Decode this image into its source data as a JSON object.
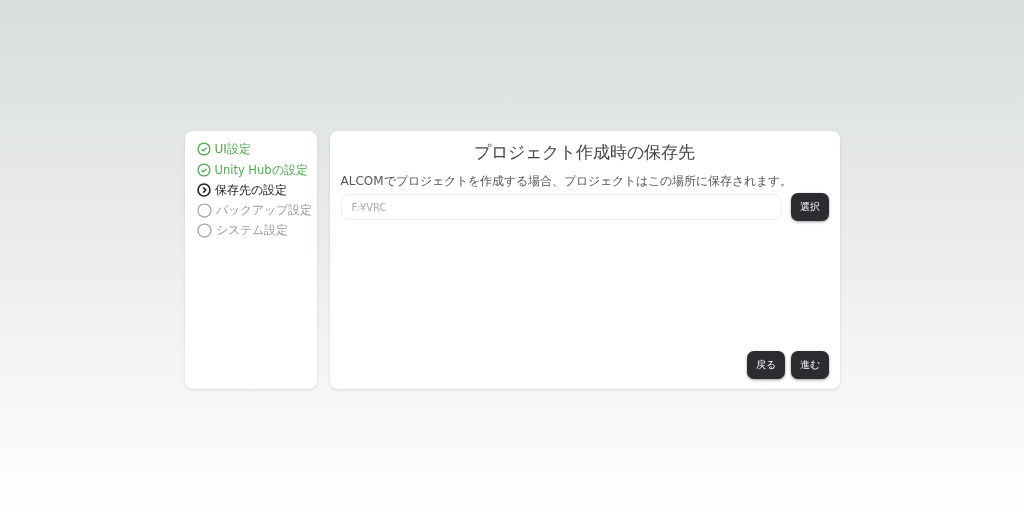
{
  "steps": [
    {
      "label": "UI設定",
      "kind": "done"
    },
    {
      "label": "Unity Hubの設定",
      "kind": "done"
    },
    {
      "label": "保存先の設定",
      "kind": "current"
    },
    {
      "label": "バックアップ設定",
      "kind": "pending"
    },
    {
      "label": "システム設定",
      "kind": "pending"
    }
  ],
  "page": {
    "title": "プロジェクト作成時の保存先",
    "description": "ALCOMでプロジェクトを作成する場合、プロジェクトはこの場所に保存されます。",
    "path_field": {
      "placeholder": "F:¥VRC"
    },
    "select_button": "選択"
  },
  "nav_buttons": [
    "戻る",
    "進む"
  ]
}
